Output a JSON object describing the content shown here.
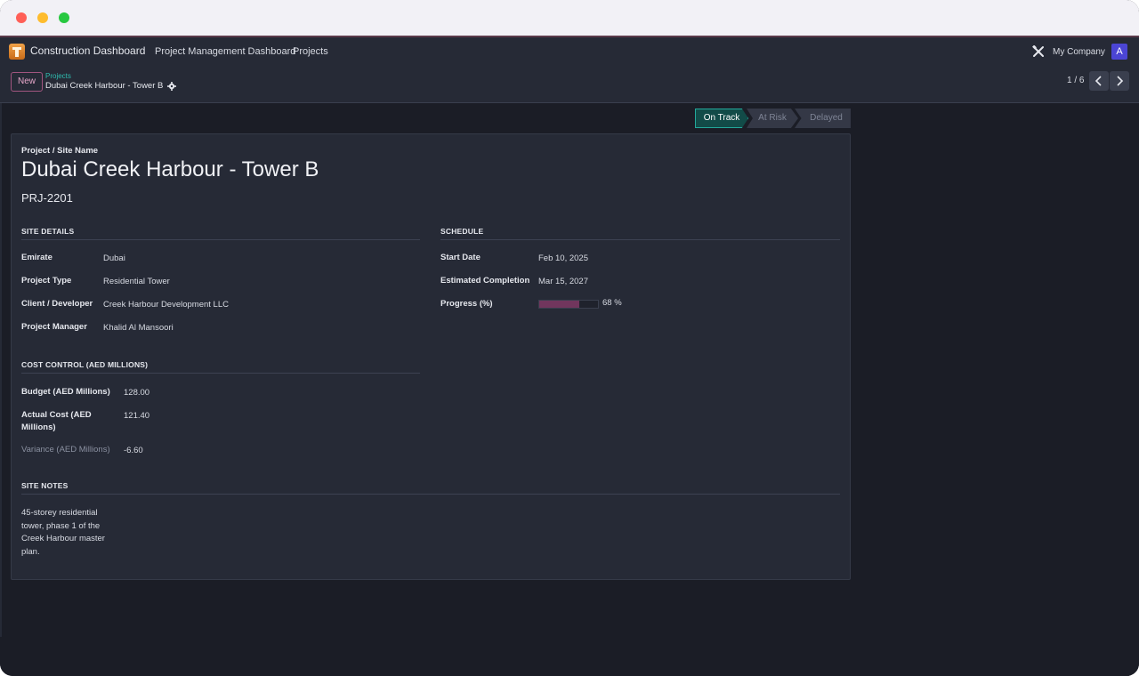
{
  "navbar": {
    "app_name": "Construction Dashboard",
    "menu": [
      "Project Management Dashboard",
      "Projects"
    ],
    "company": "My Company",
    "avatar_letter": "A",
    "icons": {
      "app": "building-app-icon",
      "tools": "tools-icon"
    }
  },
  "control": {
    "new_label": "New",
    "breadcrumb_parent": "Projects",
    "breadcrumb_current": "Dubai Creek Harbour - Tower B",
    "pager": "1 / 6"
  },
  "status": {
    "stages": [
      "On Track",
      "At Risk",
      "Delayed"
    ],
    "active": "On Track",
    "active_color": "#124b48"
  },
  "record": {
    "caption": "Project / Site Name",
    "title": "Dubai Creek Harbour - Tower B",
    "code": "PRJ-2201"
  },
  "site_details": {
    "heading": "SITE DETAILS",
    "fields": [
      {
        "label": "Emirate",
        "value": "Dubai"
      },
      {
        "label": "Project Type",
        "value": "Residential Tower"
      },
      {
        "label": "Client / Developer",
        "value": "Creek Harbour Development LLC"
      },
      {
        "label": "Project Manager",
        "value": "Khalid Al Mansoori"
      }
    ]
  },
  "schedule": {
    "heading": "SCHEDULE",
    "fields": [
      {
        "label": "Start Date",
        "value": "Feb 10, 2025"
      },
      {
        "label": "Estimated Completion",
        "value": "Mar 15, 2027"
      }
    ],
    "progress_label": "Progress (%)",
    "progress_value": 68,
    "progress_text": "68 %",
    "progress_color": "#71365d"
  },
  "cost": {
    "heading": "COST CONTROL (AED MILLIONS)",
    "fields": [
      {
        "label": "Budget (AED Millions)",
        "value": "128.00"
      },
      {
        "label": "Actual Cost (AED Millions)",
        "value": "121.40"
      },
      {
        "label": "Variance (AED Millions)",
        "value": "-6.60"
      }
    ]
  },
  "notes": {
    "heading": "SITE NOTES",
    "text": "45-storey residential tower, phase 1 of the Creek Harbour master plan."
  }
}
